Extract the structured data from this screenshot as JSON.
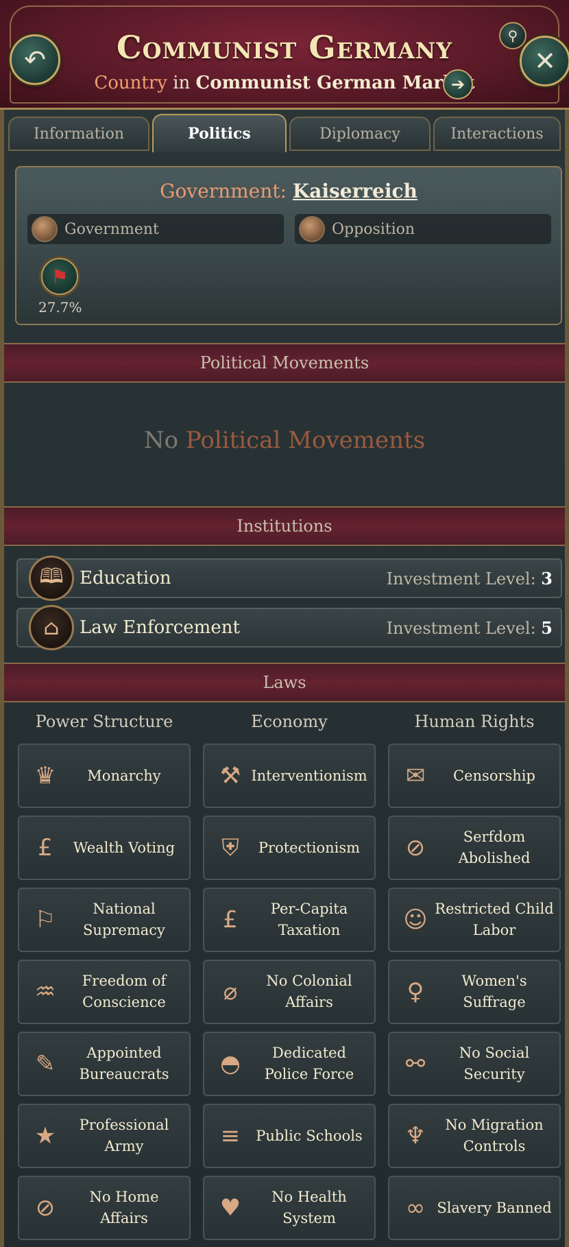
{
  "header": {
    "title": "Communist Germany",
    "subtitle_kind": "Country",
    "subtitle_in": "in",
    "subtitle_market": "Communist German Market"
  },
  "tabs": [
    {
      "label": "Information"
    },
    {
      "label": "Politics"
    },
    {
      "label": "Diplomacy"
    },
    {
      "label": "Interactions"
    }
  ],
  "government": {
    "label": "Government:",
    "name": "Kaiserreich",
    "government_bar": "Government",
    "opposition_bar": "Opposition",
    "party_percent": "27.7%"
  },
  "sections": {
    "political_movements": "Political Movements",
    "institutions": "Institutions",
    "laws": "Laws"
  },
  "movements_empty": {
    "prefix": "No",
    "highlight": "Political Movements"
  },
  "institutions": [
    {
      "name": "Education",
      "level_label": "Investment Level:",
      "level": "3",
      "icon": "book-icon"
    },
    {
      "name": "Law Enforcement",
      "level_label": "Investment Level:",
      "level": "5",
      "icon": "police-cap-icon"
    }
  ],
  "laws": {
    "columns": [
      "Power Structure",
      "Economy",
      "Human Rights"
    ],
    "power_structure": [
      {
        "label": "Monarchy",
        "icon": "crown-icon"
      },
      {
        "label": "Wealth Voting",
        "icon": "pound-icon"
      },
      {
        "label": "National Supremacy",
        "icon": "flag-hand-icon"
      },
      {
        "label": "Freedom of Conscience",
        "icon": "praying-hands-icon"
      },
      {
        "label": "Appointed Bureaucrats",
        "icon": "quill-icon"
      },
      {
        "label": "Professional Army",
        "icon": "medal-icon"
      },
      {
        "label": "No Home Affairs",
        "icon": "no-home-affairs-icon"
      }
    ],
    "economy": [
      {
        "label": "Interventionism",
        "icon": "factory-icon"
      },
      {
        "label": "Protectionism",
        "icon": "shield-icon"
      },
      {
        "label": "Per-Capita Taxation",
        "icon": "money-bag-icon"
      },
      {
        "label": "No Colonial Affairs",
        "icon": "no-colonial-icon"
      },
      {
        "label": "Dedicated Police Force",
        "icon": "police-helmet-icon"
      },
      {
        "label": "Public Schools",
        "icon": "book-hands-icon"
      },
      {
        "label": "No Health System",
        "icon": "broken-heart-icon"
      }
    ],
    "human_rights": [
      {
        "label": "Censorship",
        "icon": "censored-speech-icon"
      },
      {
        "label": "Serfdom Abolished",
        "icon": "no-serfdom-icon"
      },
      {
        "label": "Restricted Child Labor",
        "icon": "child-labor-icon"
      },
      {
        "label": "Women's Suffrage",
        "icon": "female-symbol-icon"
      },
      {
        "label": "No Social Security",
        "icon": "broken-chain-icon"
      },
      {
        "label": "No Migration Controls",
        "icon": "migrant-icon"
      },
      {
        "label": "Slavery Banned",
        "icon": "chain-icon"
      }
    ]
  }
}
